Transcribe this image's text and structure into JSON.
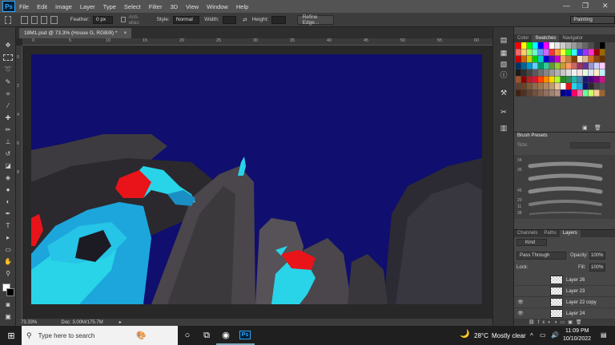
{
  "app": {
    "logo": "Ps"
  },
  "menu": [
    "File",
    "Edit",
    "Image",
    "Layer",
    "Type",
    "Select",
    "Filter",
    "3D",
    "View",
    "Window",
    "Help"
  ],
  "window_controls": {
    "minimize": "—",
    "restore": "❐",
    "close": "✕"
  },
  "options": {
    "feather_label": "Feather:",
    "feather_value": "0 px",
    "antialias_label": "Anti-alias",
    "style_label": "Style:",
    "style_value": "Normal",
    "width_label": "Width:",
    "height_label": "Height:",
    "refine_edge": "Refine Edge...",
    "workspace": "Painting"
  },
  "document": {
    "tab_title": "18M1.psd @ 73.3% (House G, RGB/8) *",
    "tab_close": "×",
    "zoom": "73.33%",
    "doc_size": "Doc: 3.00M/175.7M"
  },
  "ruler_top_ticks": [
    "0",
    "5",
    "10",
    "15",
    "20",
    "25",
    "30",
    "35",
    "40",
    "45",
    "50",
    "55",
    "60"
  ],
  "ruler_left_ticks": [
    "0",
    "2",
    "4",
    "6",
    "8",
    "1\n0",
    "1\n2",
    "1\n4",
    "1\n6"
  ],
  "panels": {
    "color_tabs": [
      "Color",
      "Swatches",
      "Navigator"
    ],
    "brush_presets": {
      "title": "Brush Presets",
      "size_label": "Size:",
      "sizes": [
        "34",
        "36",
        "45",
        "20",
        "11",
        "38"
      ]
    },
    "layers_tabs": [
      "Channels",
      "Paths",
      "Layers"
    ],
    "kind_label": "Kind",
    "blend_mode": "Pass Through",
    "opacity_label": "Opacity:",
    "opacity_value": "100%",
    "lock_label": "Lock:",
    "fill_label": "Fill:",
    "fill_value": "100%",
    "layers": [
      {
        "name": "Layer 26",
        "visible": false
      },
      {
        "name": "Layer 23",
        "visible": false
      },
      {
        "name": "Layer 22 copy",
        "visible": true
      },
      {
        "name": "Layer 24",
        "visible": true
      }
    ]
  },
  "taskbar": {
    "search_placeholder": "Type here to search",
    "temperature": "28°C",
    "weather": "Mostly clear",
    "time": "11:09 PM",
    "date": "10/10/2022"
  },
  "colors": {
    "canvas_sky": "#100e6f",
    "accent_cyan": "#29d4e8",
    "accent_red": "#e8141a"
  }
}
